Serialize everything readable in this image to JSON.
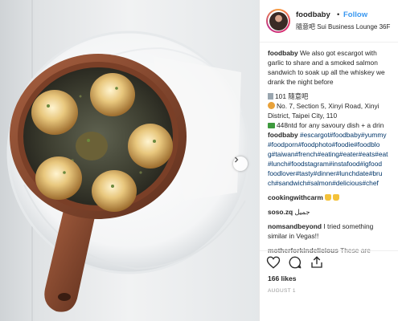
{
  "header": {
    "username": "foodbaby",
    "separator": "•",
    "follow_label": "Follow",
    "location": "隨意吧 Sui Business Lounge 36F"
  },
  "caption": {
    "username": "foodbaby",
    "lines": [
      "We also got escargot with",
      "garlic to share and a smoked salmon",
      "sandwich to soak up all the whiskey we",
      "drank the night before"
    ],
    "venue_line": "101 隨意吧",
    "address_lines": [
      "No. 7, Section 5, Xinyi Road, Xinyi",
      "District, Taipei City, 110"
    ],
    "price_line": "448ntd for any savoury dish + a drin",
    "hashtag_user": "foodbaby",
    "hashtag_lines": [
      "#escargot#foodbaby#yummy",
      "#foodporn#foodphoto#foodie#foodblo",
      "g#taiwan#french#eating#eater#eats#eat",
      "#lunch#foodstagram#instafood#igfood",
      "foodlover#tasty#dinner#lunchdate#bru",
      "ch#sandwich#salmon#delicious#chef"
    ]
  },
  "comments": [
    {
      "username": "cookingwithcarm",
      "text": ""
    },
    {
      "username": "soso.zq",
      "text": "جميل"
    },
    {
      "username": "nomsandbeyond",
      "text": "I tried something similar in Vegas!!",
      "text_lines": [
        "I tried something",
        "similar in Vegas!!"
      ]
    },
    {
      "username": "motherforkindelicious",
      "text": "These are"
    }
  ],
  "icons": {
    "like": "heart-icon",
    "comment": "comment-icon",
    "share": "share-icon",
    "next": "chevron-right-icon"
  },
  "likes_label": "166 likes",
  "date_label": "AUGUST 1",
  "colors": {
    "follow": "#3897f0",
    "hashtag": "#003569",
    "text": "#262626"
  }
}
